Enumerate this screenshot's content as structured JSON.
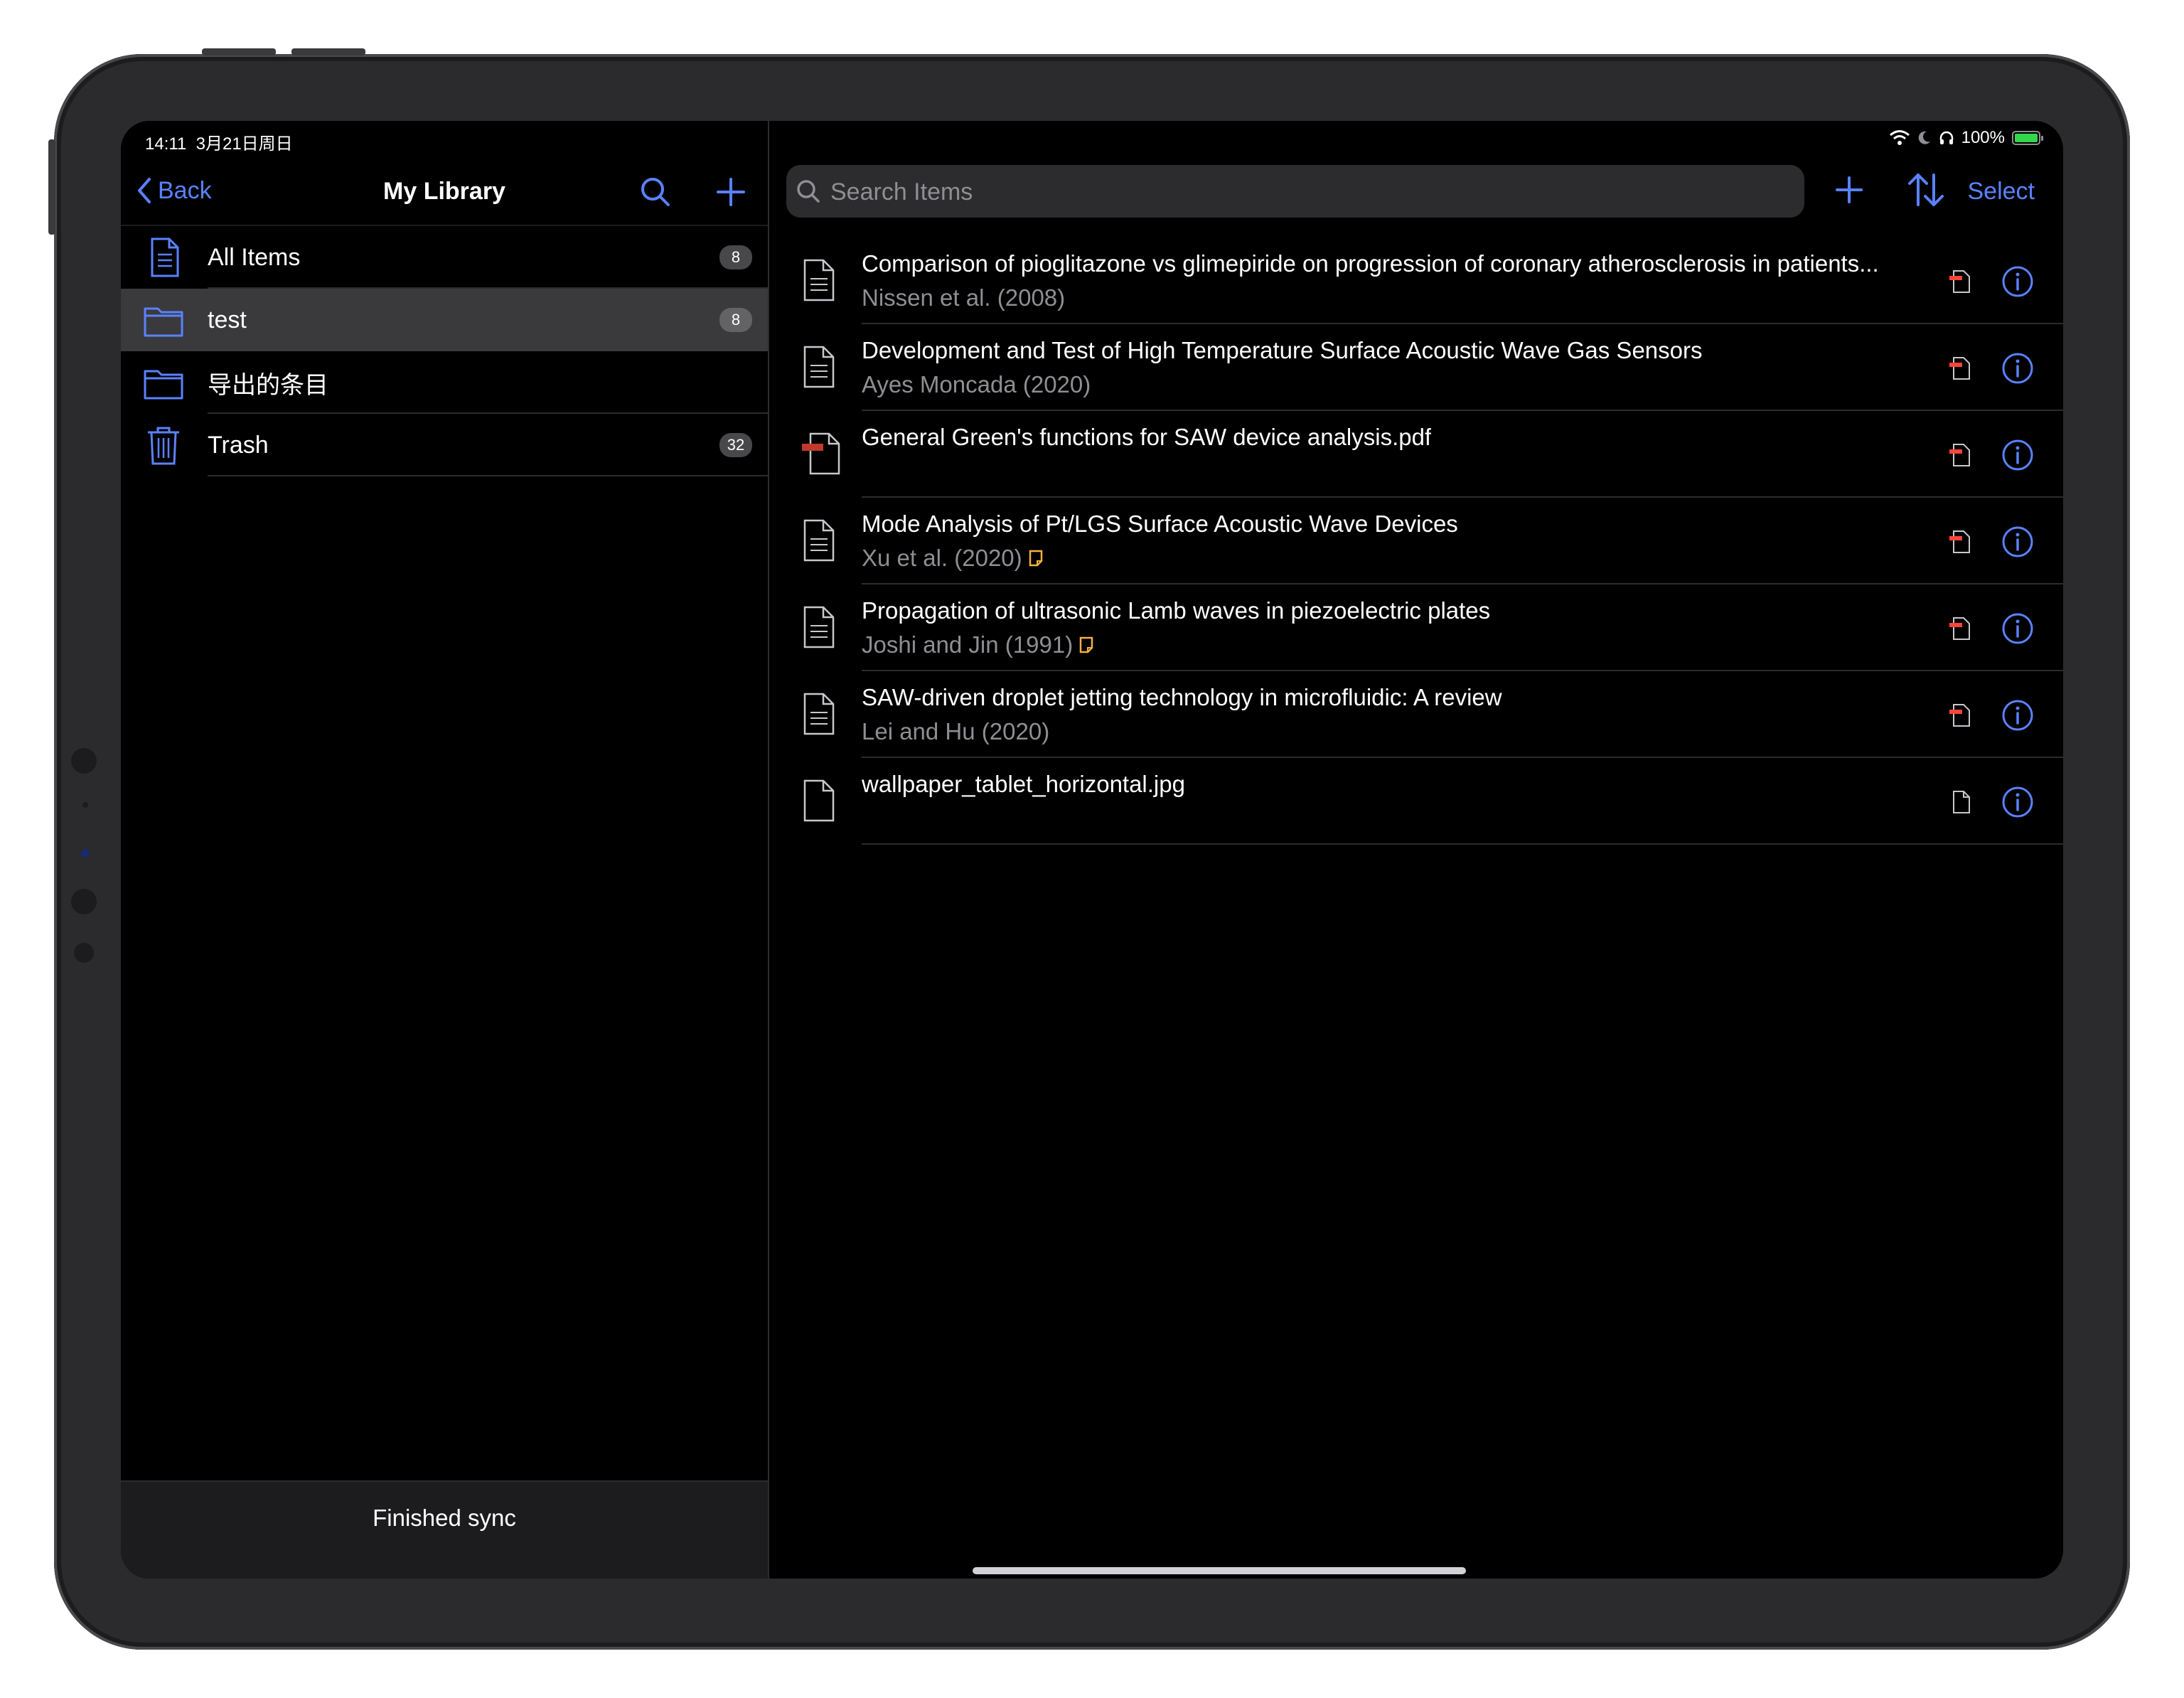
{
  "status": {
    "time": "14:11",
    "date": "3月21日周日",
    "battery": "100%"
  },
  "sidebar": {
    "back_label": "Back",
    "title": "My Library",
    "collections": [
      {
        "label": "All Items",
        "icon": "document-icon",
        "count": "8"
      },
      {
        "label": "test",
        "icon": "folder-icon",
        "count": "8",
        "selected": true
      },
      {
        "label": "导出的条目",
        "icon": "folder-icon",
        "count": ""
      },
      {
        "label": "Trash",
        "icon": "trash-icon",
        "count": "32"
      }
    ],
    "footer": "Finished sync"
  },
  "detail": {
    "search_placeholder": "Search Items",
    "select_label": "Select",
    "items": [
      {
        "title": "Comparison of pioglitazone vs glimepiride on progression of coronary atherosclerosis in patients...",
        "subtitle": "Nissen et al. (2008)"
      },
      {
        "title": "Development and Test of High Temperature Surface Acoustic Wave Gas Sensors",
        "subtitle": "Ayes Moncada (2020)"
      },
      {
        "title": "General Green's functions for SAW device analysis.pdf",
        "subtitle": ""
      },
      {
        "title": "Mode Analysis of Pt/LGS Surface Acoustic Wave Devices",
        "subtitle": "Xu et al. (2020)"
      },
      {
        "title": "Propagation of ultrasonic Lamb waves in piezoelectric plates",
        "subtitle": "Joshi and Jin (1991)"
      },
      {
        "title": "SAW-driven droplet jetting technology in microfluidic: A review",
        "subtitle": "Lei and Hu (2020)"
      },
      {
        "title": "wallpaper_tablet_horizontal.jpg",
        "subtitle": ""
      }
    ]
  },
  "colors": {
    "accent": "#5a82ff",
    "pdf_red": "#ff453a",
    "note_yellow": "#f5b041",
    "selected_bg": "#3a3a3c"
  }
}
